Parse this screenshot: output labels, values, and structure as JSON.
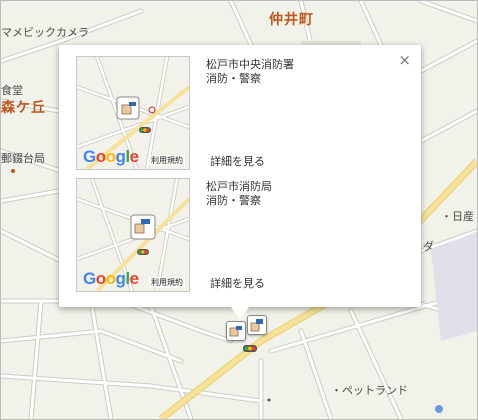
{
  "map": {
    "labels": {
      "camera_store": "マメビックカメラ",
      "naka_cho": "仲井町",
      "shokudo": "食堂",
      "gaoka": "森ケ丘",
      "post_office": "郵錣台局",
      "nissan": "・日産",
      "da": "ダ",
      "pet_land": "・ペットランド"
    },
    "colors": {
      "background": "#f1f3ea",
      "road": "#ffffff",
      "road_edge": "#c9cdc3",
      "main_road": "#f6e29a",
      "label_orange": "#c0561b"
    }
  },
  "popup": {
    "close_label": "×",
    "entries": [
      {
        "name": "松戸市中央消防署",
        "category": "消防・警察",
        "detail_link": "詳細を見る",
        "google_logo": "Google",
        "terms": "利用規約"
      },
      {
        "name": "松戸市消防局",
        "category": "消防・警察",
        "detail_link": "詳細を見る",
        "google_logo": "Google",
        "terms": "利用規約"
      }
    ]
  },
  "icons": {
    "map_marker": "fire-station-marker-icon",
    "thumb_marker": "fire-station-marker-icon",
    "traffic_signal": "traffic-signal-icon",
    "close": "close-icon"
  }
}
